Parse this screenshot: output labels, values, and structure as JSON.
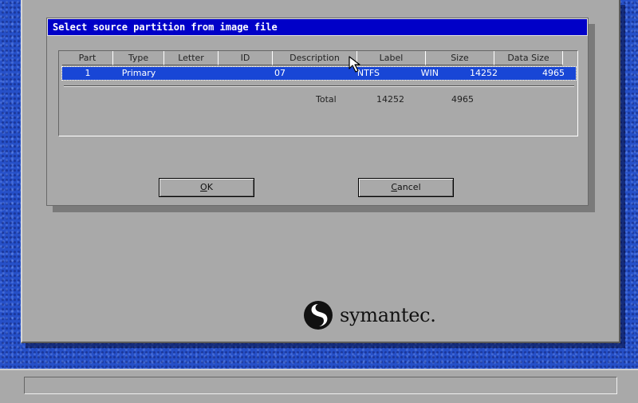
{
  "dialog": {
    "title": "Select source partition from image file",
    "columns": [
      "Part",
      "Type",
      "Letter",
      "ID",
      "Description",
      "Label",
      "Size",
      "Data Size"
    ],
    "rows": [
      {
        "part": "1",
        "type": "Primary",
        "letter": "",
        "id": "07",
        "description": "NTFS",
        "label": "WIN",
        "size": "14252",
        "data_size": "4965"
      }
    ],
    "totals": {
      "label": "Total",
      "size": "14252",
      "data_size": "4965"
    },
    "ok_accel": "O",
    "ok_rest": "K",
    "cancel_accel": "C",
    "cancel_rest": "ancel"
  },
  "logo": {
    "text": "symantec."
  },
  "status_bar": {
    "text": ""
  },
  "colors": {
    "title_bar": "#0000c8",
    "selection": "#1846d6",
    "desktop": "#2650c8",
    "window": "#a9a9a9"
  }
}
